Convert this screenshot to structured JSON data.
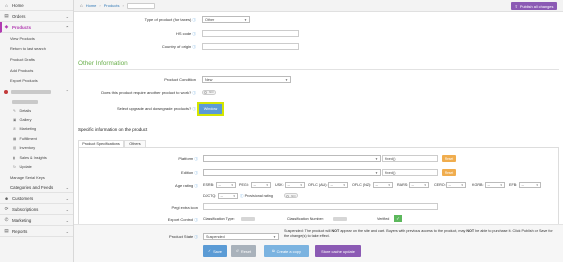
{
  "sidebar": {
    "items": [
      {
        "label": "Home",
        "icon": "home-icon",
        "glyph": "⌂"
      },
      {
        "label": "Orders",
        "icon": "cart-icon",
        "glyph": "▤"
      },
      {
        "label": "Products",
        "icon": "tag-icon",
        "glyph": "◈"
      }
    ],
    "product_sub": [
      "View Products",
      "Return to last search",
      "Product Drafts",
      "Add Products",
      "Export Products"
    ],
    "product_children": [
      {
        "label": "Details",
        "glyph": "✎"
      },
      {
        "label": "Gallery",
        "glyph": "▣"
      },
      {
        "label": "Marketing",
        "glyph": "✆"
      },
      {
        "label": "Fulfillment",
        "glyph": "▦"
      },
      {
        "label": "Inventory",
        "glyph": "▥"
      },
      {
        "label": "Sales & Insights",
        "glyph": "▮"
      },
      {
        "label": "Update",
        "glyph": "↻"
      }
    ],
    "manage_serial": "Manage Serial Keys",
    "sections": [
      {
        "label": "Categories and Feeds"
      },
      {
        "label": "Customers",
        "glyph": "☻"
      },
      {
        "label": "Subscriptions",
        "glyph": "⟳"
      },
      {
        "label": "Marketing",
        "glyph": "✆"
      },
      {
        "label": "Reports",
        "glyph": "▤"
      }
    ]
  },
  "header": {
    "breadcrumb_home": "Home",
    "breadcrumb_products": "Products",
    "publish_label": "Publish all changes"
  },
  "form": {
    "product_type_label": "Type of product (for taxes)",
    "product_type_value": "Other",
    "hs_code_label": "HS code",
    "country_origin_label": "Country of origin",
    "other_info_title": "Other Information",
    "condition_label": "Product Condition",
    "condition_value": "New",
    "require_label": "Does this product require another product to work?",
    "require_toggle": "NO",
    "upgrade_label": "Select upgrade and downgrade products?",
    "window_btn": "Window"
  },
  "specific": {
    "title": "Specific information on the product",
    "tabs": [
      "Product Specifications",
      "Others"
    ],
    "platform_label": "Platform",
    "platform_fixed": "fixed()",
    "platform_btn": "Reset",
    "edition_label": "Edition",
    "edition_fixed": "fixed()",
    "edition_btn": "Reset",
    "age_label": "Age rating",
    "ratings": [
      "ESRB:",
      "PEGI:",
      "USK:",
      "OFLC (AU):",
      "OFLC (NZ):",
      "RARS:",
      "CERO:",
      "KGRB:",
      "EFB:"
    ],
    "rating_default": "--",
    "djctq": "DJCTQ:",
    "provisional_label": "Provisional rating",
    "provisional_toggle": "NO",
    "pegi_icon_label": "Pegi extra icon",
    "export_label": "Export Control",
    "class_type_label": "Classification Type:",
    "class_number_label": "Classification Number:",
    "verified_label": "Verified",
    "verified_check": "✓"
  },
  "bottom": {
    "state_label": "Product State",
    "state_value": "Suspended",
    "note_1": "Suspended: The product will ",
    "note_not1": "NOT",
    "note_2": " appear on the site and cart. Buyers with previous access to the product, may ",
    "note_not2": "NOT",
    "note_3": " be able to purchase it. Click Publish or Save for the change(s) to take effect.",
    "buttons": [
      {
        "label": "Save",
        "icon": "✓"
      },
      {
        "label": "Reset",
        "icon": "↺"
      },
      {
        "label": "Create a copy",
        "icon": "⧉"
      },
      {
        "label": "Store cache update",
        "icon": ""
      }
    ]
  },
  "colors": {
    "accent_purple": "#8b5ab4",
    "section_green": "#6ab04c",
    "button_blue": "#5b9bd5",
    "highlight_yellow": "#d4e600",
    "verify_green": "#5cb85c",
    "reset_orange": "#f0ad4e"
  }
}
